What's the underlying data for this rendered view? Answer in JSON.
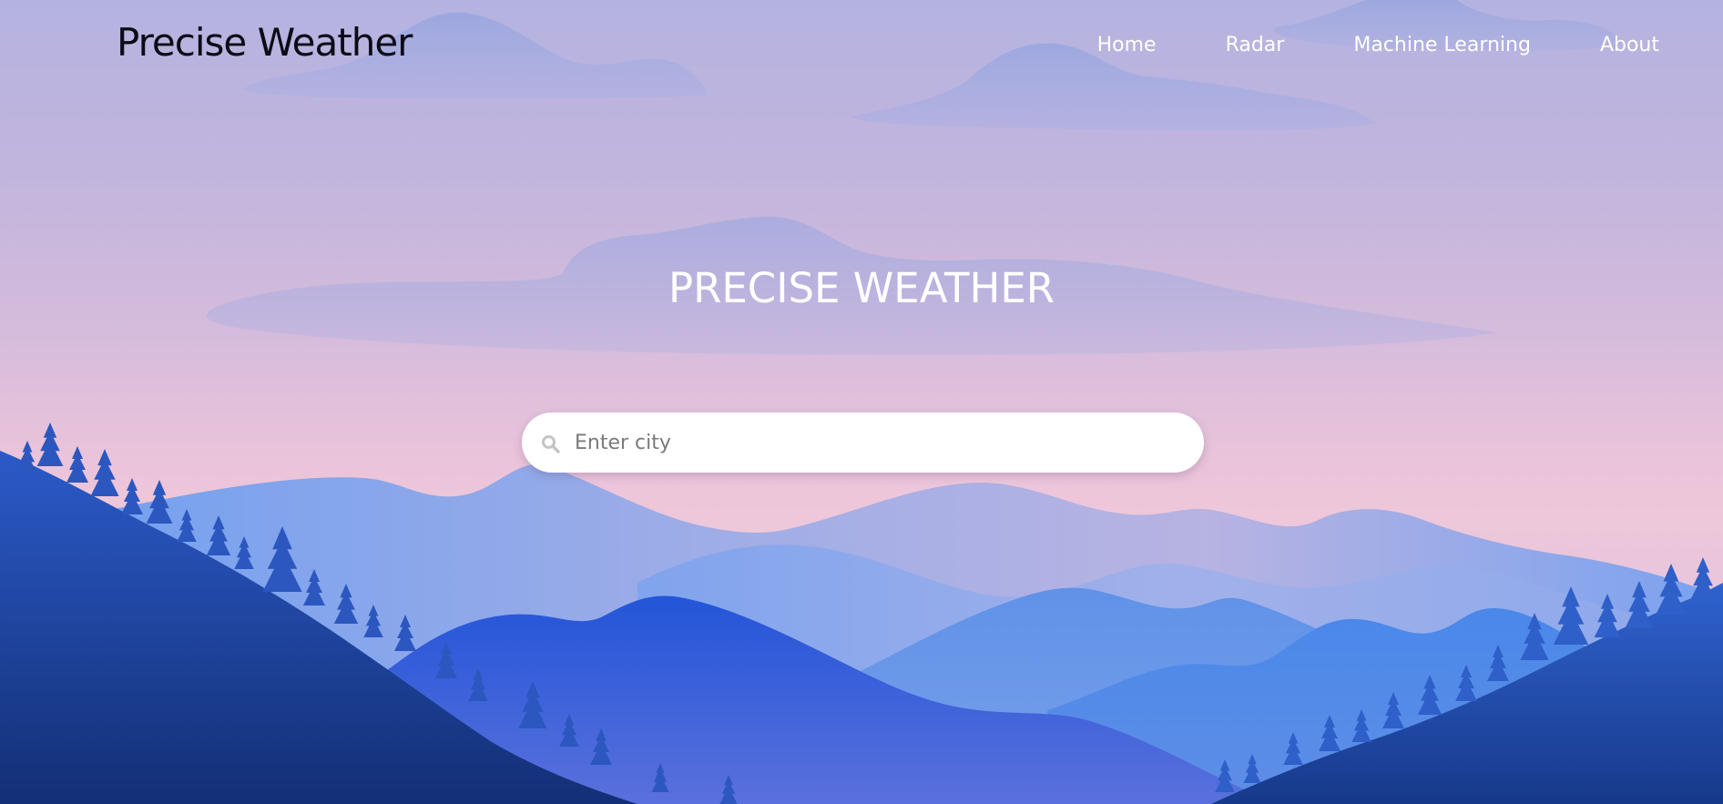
{
  "header": {
    "brand": "Precise Weather",
    "nav": [
      {
        "label": "Home"
      },
      {
        "label": "Radar"
      },
      {
        "label": "Machine Learning"
      },
      {
        "label": "About"
      }
    ]
  },
  "hero": {
    "title": "PRECISE WEATHER"
  },
  "search": {
    "placeholder": "Enter city",
    "value": "",
    "icon": "search-icon"
  },
  "colors": {
    "sky_top": "#b4b3e0",
    "sky_horizon": "#eec7da",
    "mountain_far": "#7fa3ee",
    "mountain_mid": "#2a5bd8",
    "forest": "#1e3f95"
  }
}
